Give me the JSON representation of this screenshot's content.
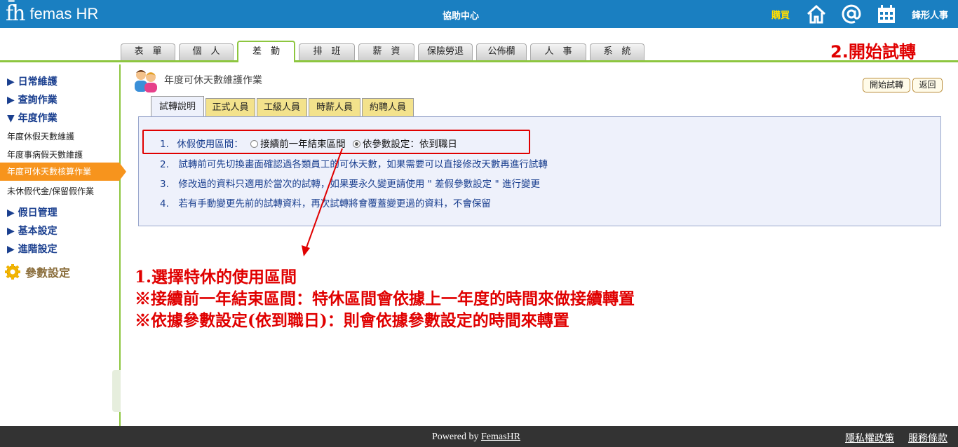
{
  "header": {
    "logo_mark": "f̄h",
    "logo_text": "femas HR",
    "center_title": "協助中心",
    "buy_label": "購買",
    "company_name": "鋒形人事",
    "icons": [
      "home-icon",
      "at-icon",
      "calendar-icon"
    ]
  },
  "tabs": [
    "表　單",
    "個　人",
    "差　勤",
    "排　班",
    "薪　資",
    "保險勞退",
    "公佈欄",
    "人　事",
    "系　統"
  ],
  "active_tab": "差　勤",
  "annotation_start": "2.開始試轉",
  "sidebar": {
    "groups": [
      "▶ 日常維護",
      "▶ 查詢作業",
      "▼ 年度作業"
    ],
    "subitems": [
      "年度休假天數維護",
      "年度事病假天數維護",
      "年度可休天數核算作業",
      "未休假代金/保留假作業"
    ],
    "groups2": [
      "▶ 假日管理",
      "▶ 基本設定",
      "▶ 進階設定"
    ],
    "param_label": "參數設定"
  },
  "page": {
    "title": "年度可休天數維護作業",
    "start_button": "開始試轉",
    "back_button": "返回"
  },
  "subtabs": [
    "試轉說明",
    "正式人員",
    "工級人員",
    "時薪人員",
    "約聘人員"
  ],
  "instructions": {
    "item1_num": "1.",
    "item1_label": "休假使用區間：",
    "option1": "接續前一年結束區間",
    "option2": "依參數設定：依到職日",
    "selected_option": "依參數設定：依到職日",
    "item2": "2.　試轉前可先切換畫面確認過各類員工的可休天數，如果需要可以直接修改天數再進行試轉",
    "item3": "3.　修改過的資料只適用於當次的試轉，如果要永久變更請使用 \" 差假參數設定 \" 進行變更",
    "item4": "4.　若有手動變更先前的試轉資料，再次試轉將會覆蓋變更過的資料，不會保留"
  },
  "annotation": {
    "line1": "1.選擇特休的使用區間",
    "line2": "※接續前一年結束區間：特休區間會依據上一年度的時間來做接續轉置",
    "line3": "※依據參數設定(依到職日)：則會依據參數設定的時間來轉置"
  },
  "footer": {
    "powered_prefix": "Powered by ",
    "powered_link": "FemasHR",
    "privacy": "隱私權政策",
    "terms": "服務條款"
  },
  "colors": {
    "header_bg": "#1a7fc1",
    "accent_green": "#8dc63f",
    "active_menu": "#f7941d",
    "annotation_red": "#e00000"
  }
}
